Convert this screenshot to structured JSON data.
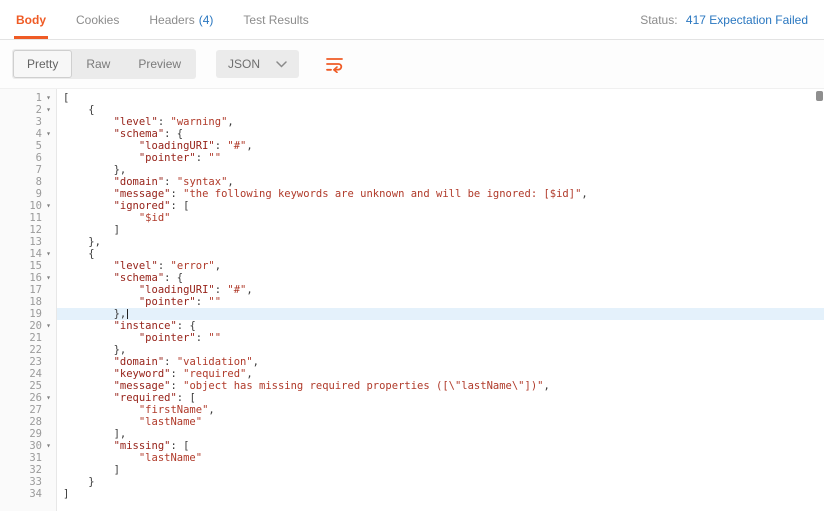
{
  "tabs": [
    {
      "label": "Body",
      "active": true
    },
    {
      "label": "Cookies",
      "active": false
    },
    {
      "label": "Headers",
      "count": "(4)",
      "active": false
    },
    {
      "label": "Test Results",
      "active": false
    }
  ],
  "status": {
    "label": "Status:",
    "value": "417 Expectation Failed"
  },
  "toolbar": {
    "views": [
      {
        "label": "Pretty",
        "active": true
      },
      {
        "label": "Raw",
        "active": false
      },
      {
        "label": "Preview",
        "active": false
      }
    ],
    "language": "JSON",
    "chevron_icon": "chevron-down-icon",
    "wrap_icon": "wrap-text-icon"
  },
  "editor": {
    "language": "json",
    "active_line": 19,
    "fold_lines": [
      1,
      2,
      4,
      10,
      14,
      16,
      20,
      26,
      30
    ],
    "lines": [
      [
        [
          "pl",
          "["
        ]
      ],
      [
        [
          "pl",
          "    {"
        ]
      ],
      [
        [
          "pl",
          "        "
        ],
        [
          "k",
          "\"level\""
        ],
        [
          "pl",
          ": "
        ],
        [
          "s",
          "\"warning\""
        ],
        [
          "pl",
          ","
        ]
      ],
      [
        [
          "pl",
          "        "
        ],
        [
          "k",
          "\"schema\""
        ],
        [
          "pl",
          ": {"
        ]
      ],
      [
        [
          "pl",
          "            "
        ],
        [
          "k",
          "\"loadingURI\""
        ],
        [
          "pl",
          ": "
        ],
        [
          "s",
          "\"#\""
        ],
        [
          "pl",
          ","
        ]
      ],
      [
        [
          "pl",
          "            "
        ],
        [
          "k",
          "\"pointer\""
        ],
        [
          "pl",
          ": "
        ],
        [
          "s",
          "\"\""
        ]
      ],
      [
        [
          "pl",
          "        },"
        ]
      ],
      [
        [
          "pl",
          "        "
        ],
        [
          "k",
          "\"domain\""
        ],
        [
          "pl",
          ": "
        ],
        [
          "s",
          "\"syntax\""
        ],
        [
          "pl",
          ","
        ]
      ],
      [
        [
          "pl",
          "        "
        ],
        [
          "k",
          "\"message\""
        ],
        [
          "pl",
          ": "
        ],
        [
          "s",
          "\"the following keywords are unknown and will be ignored: [$id]\""
        ],
        [
          "pl",
          ","
        ]
      ],
      [
        [
          "pl",
          "        "
        ],
        [
          "k",
          "\"ignored\""
        ],
        [
          "pl",
          ": ["
        ]
      ],
      [
        [
          "pl",
          "            "
        ],
        [
          "s",
          "\"$id\""
        ]
      ],
      [
        [
          "pl",
          "        ]"
        ]
      ],
      [
        [
          "pl",
          "    },"
        ]
      ],
      [
        [
          "pl",
          "    {"
        ]
      ],
      [
        [
          "pl",
          "        "
        ],
        [
          "k",
          "\"level\""
        ],
        [
          "pl",
          ": "
        ],
        [
          "s",
          "\"error\""
        ],
        [
          "pl",
          ","
        ]
      ],
      [
        [
          "pl",
          "        "
        ],
        [
          "k",
          "\"schema\""
        ],
        [
          "pl",
          ": {"
        ]
      ],
      [
        [
          "pl",
          "            "
        ],
        [
          "k",
          "\"loadingURI\""
        ],
        [
          "pl",
          ": "
        ],
        [
          "s",
          "\"#\""
        ],
        [
          "pl",
          ","
        ]
      ],
      [
        [
          "pl",
          "            "
        ],
        [
          "k",
          "\"pointer\""
        ],
        [
          "pl",
          ": "
        ],
        [
          "s",
          "\"\""
        ]
      ],
      [
        [
          "pl",
          "        },"
        ]
      ],
      [
        [
          "pl",
          "        "
        ],
        [
          "k",
          "\"instance\""
        ],
        [
          "pl",
          ": {"
        ]
      ],
      [
        [
          "pl",
          "            "
        ],
        [
          "k",
          "\"pointer\""
        ],
        [
          "pl",
          ": "
        ],
        [
          "s",
          "\"\""
        ]
      ],
      [
        [
          "pl",
          "        },"
        ]
      ],
      [
        [
          "pl",
          "        "
        ],
        [
          "k",
          "\"domain\""
        ],
        [
          "pl",
          ": "
        ],
        [
          "s",
          "\"validation\""
        ],
        [
          "pl",
          ","
        ]
      ],
      [
        [
          "pl",
          "        "
        ],
        [
          "k",
          "\"keyword\""
        ],
        [
          "pl",
          ": "
        ],
        [
          "s",
          "\"required\""
        ],
        [
          "pl",
          ","
        ]
      ],
      [
        [
          "pl",
          "        "
        ],
        [
          "k",
          "\"message\""
        ],
        [
          "pl",
          ": "
        ],
        [
          "s",
          "\"object has missing required properties ([\\\"lastName\\\"])\""
        ],
        [
          "pl",
          ","
        ]
      ],
      [
        [
          "pl",
          "        "
        ],
        [
          "k",
          "\"required\""
        ],
        [
          "pl",
          ": ["
        ]
      ],
      [
        [
          "pl",
          "            "
        ],
        [
          "s",
          "\"firstName\""
        ],
        [
          "pl",
          ","
        ]
      ],
      [
        [
          "pl",
          "            "
        ],
        [
          "s",
          "\"lastName\""
        ]
      ],
      [
        [
          "pl",
          "        ],"
        ]
      ],
      [
        [
          "pl",
          "        "
        ],
        [
          "k",
          "\"missing\""
        ],
        [
          "pl",
          ": ["
        ]
      ],
      [
        [
          "pl",
          "            "
        ],
        [
          "s",
          "\"lastName\""
        ]
      ],
      [
        [
          "pl",
          "        ]"
        ]
      ],
      [
        [
          "pl",
          "    }"
        ]
      ],
      [
        [
          "pl",
          "]"
        ]
      ]
    ]
  },
  "colors": {
    "accent": "#ef5b25",
    "status_blue": "#2a77c0",
    "active_line_bg": "#e4f1fb",
    "key_color": "#97231a",
    "string_color": "#b03a2a"
  }
}
